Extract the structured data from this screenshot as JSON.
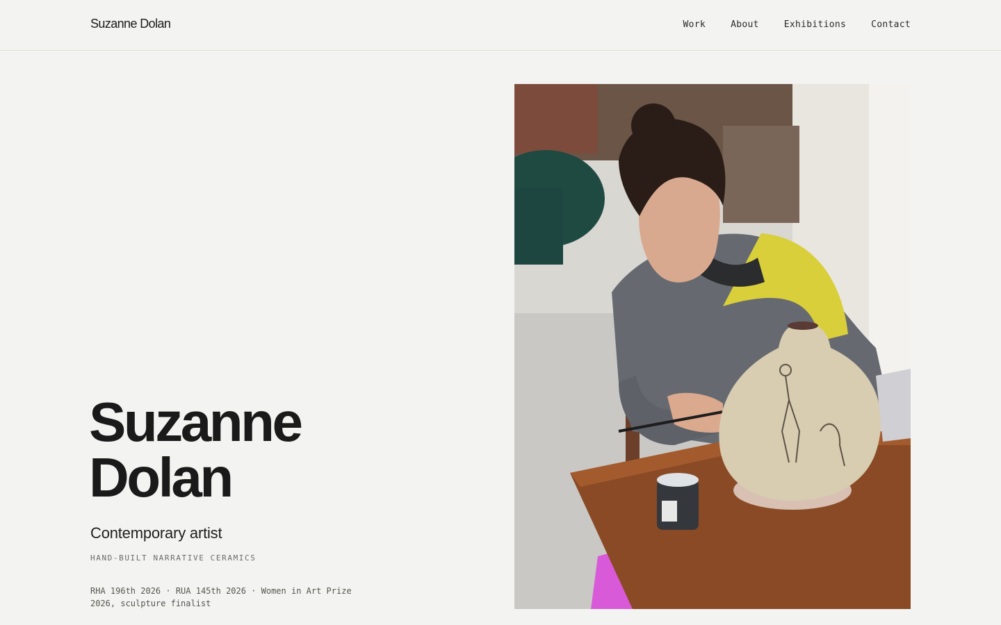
{
  "header": {
    "brand": "Suzanne Dolan",
    "nav": [
      {
        "label": "Work"
      },
      {
        "label": "About"
      },
      {
        "label": "Exhibitions"
      },
      {
        "label": "Contact"
      }
    ]
  },
  "hero": {
    "name_line1": "Suzanne",
    "name_line2": "Dolan",
    "subtitle": "Contemporary artist",
    "tagline": "HAND-BUILT NARRATIVE CERAMICS",
    "awards": "RHA 196th 2026 · RUA 145th 2026 · Women in Art Prize 2026, sculpture finalist"
  },
  "colors": {
    "background": "#f3f3f1",
    "text": "#1a1a1a",
    "muted": "#6b6b68"
  }
}
